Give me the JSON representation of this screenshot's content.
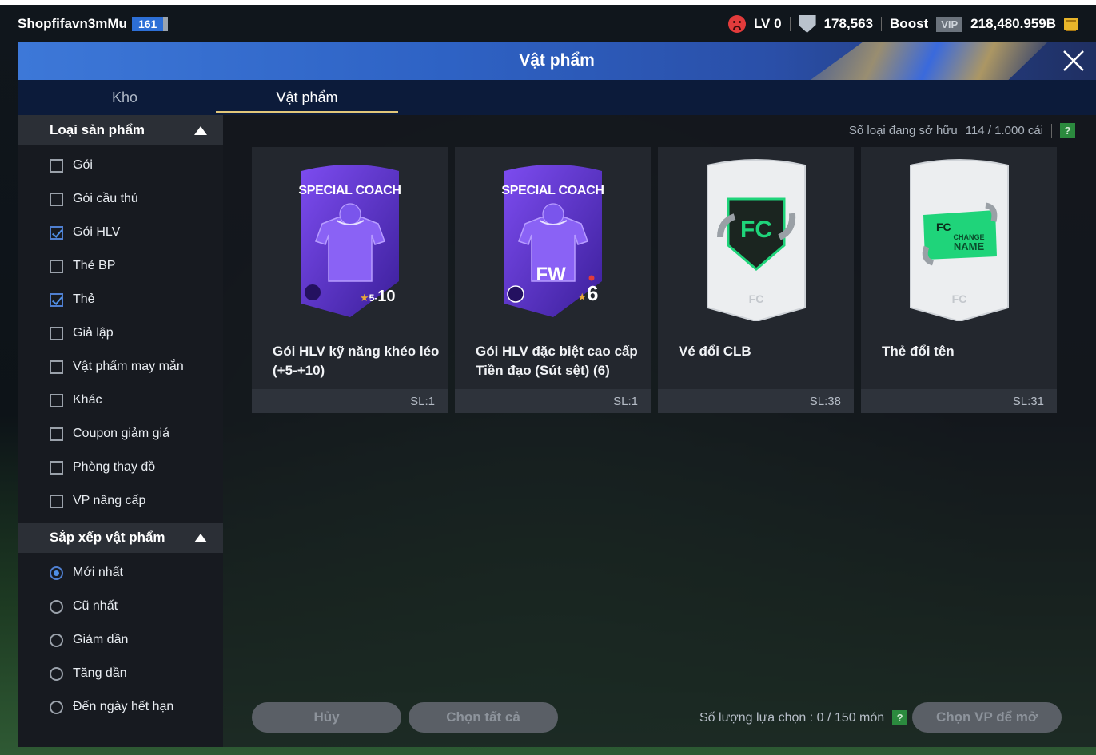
{
  "statusbar": {
    "username": "Shopfifavn3mMu",
    "level_chip": "161",
    "lv_label": "LV 0",
    "shield_value": "178,563",
    "boost_label": "Boost",
    "vip_label": "VIP",
    "bp_value": "218,480.959B"
  },
  "window": {
    "title": "Vật phẩm",
    "tabs": [
      {
        "label": "Kho",
        "active": false
      },
      {
        "label": "Vật phẩm",
        "active": true
      }
    ]
  },
  "sidebar": {
    "filter_title": "Loại sản phẩm",
    "filters": [
      {
        "label": "Gói",
        "checked": false
      },
      {
        "label": "Gói cầu thủ",
        "checked": false
      },
      {
        "label": "Gói HLV",
        "checked": true
      },
      {
        "label": "Thẻ BP",
        "checked": false
      },
      {
        "label": "Thẻ",
        "checked": true
      },
      {
        "label": "Giả lập",
        "checked": false
      },
      {
        "label": "Vật phẩm may mắn",
        "checked": false
      },
      {
        "label": "Khác",
        "checked": false
      },
      {
        "label": "Coupon giảm giá",
        "checked": false
      },
      {
        "label": "Phòng thay đồ",
        "checked": false
      },
      {
        "label": "VP nâng cấp",
        "checked": false
      }
    ],
    "sort_title": "Sắp xếp vật phẩm",
    "sorts": [
      {
        "label": "Mới nhất",
        "selected": true
      },
      {
        "label": "Cũ nhất",
        "selected": false
      },
      {
        "label": "Giảm dần",
        "selected": false
      },
      {
        "label": "Tăng dần",
        "selected": false
      },
      {
        "label": "Đến ngày hết hạn",
        "selected": false
      }
    ]
  },
  "main": {
    "owned_label": "Số loại đang sở hữu",
    "owned_value": "114 / 1.000 cái",
    "help": "?",
    "items": [
      {
        "name": "Gói HLV kỹ năng khéo léo (+5-+10)",
        "qty": "SL:1",
        "card_title": "SPECIAL COACH",
        "rating_range": "5-",
        "rating": "10"
      },
      {
        "name": "Gói HLV đặc biệt cao cấp Tiền đạo (Sút sệt) (6)",
        "qty": "SL:1",
        "card_title": "SPECIAL COACH",
        "position": "FW",
        "rating": "6"
      },
      {
        "name": "Vé đổi CLB",
        "qty": "SL:38"
      },
      {
        "name": "Thẻ đổi tên",
        "qty": "SL:31",
        "card_text_top": "CHANGE",
        "card_text_bottom": "NAME"
      }
    ],
    "footer": {
      "cancel_label": "Hủy",
      "select_all_label": "Chọn tất cả",
      "selection_label": "Số lượng lựa chọn : 0 / 150 món",
      "open_label": "Chọn VP để mở"
    }
  },
  "colors": {
    "accent_gold": "#e2c779",
    "title_blue": "#2e62c4",
    "check_blue": "#4f8fe6",
    "coach_purple": "#6a3fd6",
    "fc_green": "#1fd47a"
  }
}
